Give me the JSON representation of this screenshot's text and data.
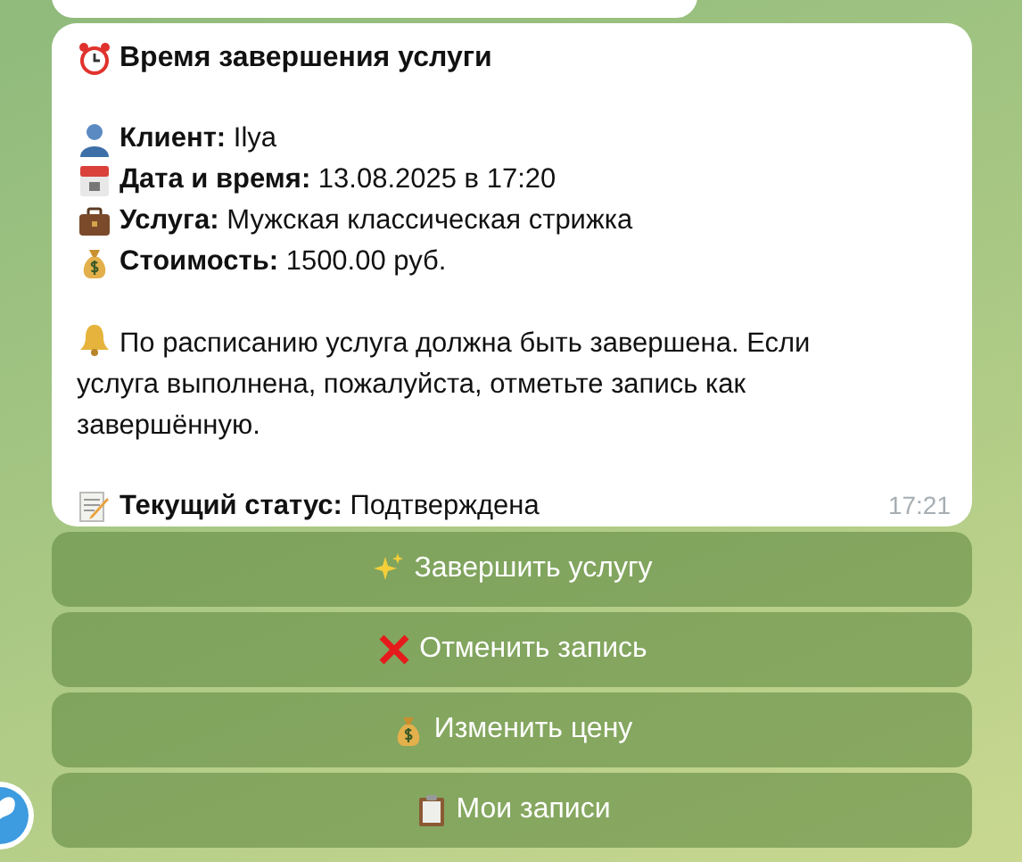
{
  "message": {
    "title": {
      "kind": "alarm-clock",
      "text": "Время завершения услуги"
    },
    "details": [
      {
        "kind": "person",
        "text": "**Клиент:** Ilya"
      },
      {
        "kind": "calendar",
        "text": "**Дата и время:** 13.08.2025 в 17:20"
      },
      {
        "kind": "briefcase",
        "text": "**Услуга:** Мужская классическая стрижка"
      },
      {
        "kind": "money-bag",
        "text": "**Стоимость:** 1500.00 руб."
      }
    ],
    "notice": {
      "kind": "bell",
      "text": "По расписанию услуга должна быть завершена. Если услуга выполнена, пожалуйста, отметьте запись как завершённую."
    },
    "status": {
      "kind": "memo",
      "text": "**Текущий статус:** Подтверждена"
    },
    "time": "17:21"
  },
  "buttons": [
    {
      "kind": "sparkles",
      "label": "Завершить услугу"
    },
    {
      "kind": "cross",
      "label": "Отменить запись"
    },
    {
      "kind": "money-bag",
      "label": "Изменить цену"
    },
    {
      "kind": "clipboard",
      "label": "Мои записи"
    }
  ]
}
